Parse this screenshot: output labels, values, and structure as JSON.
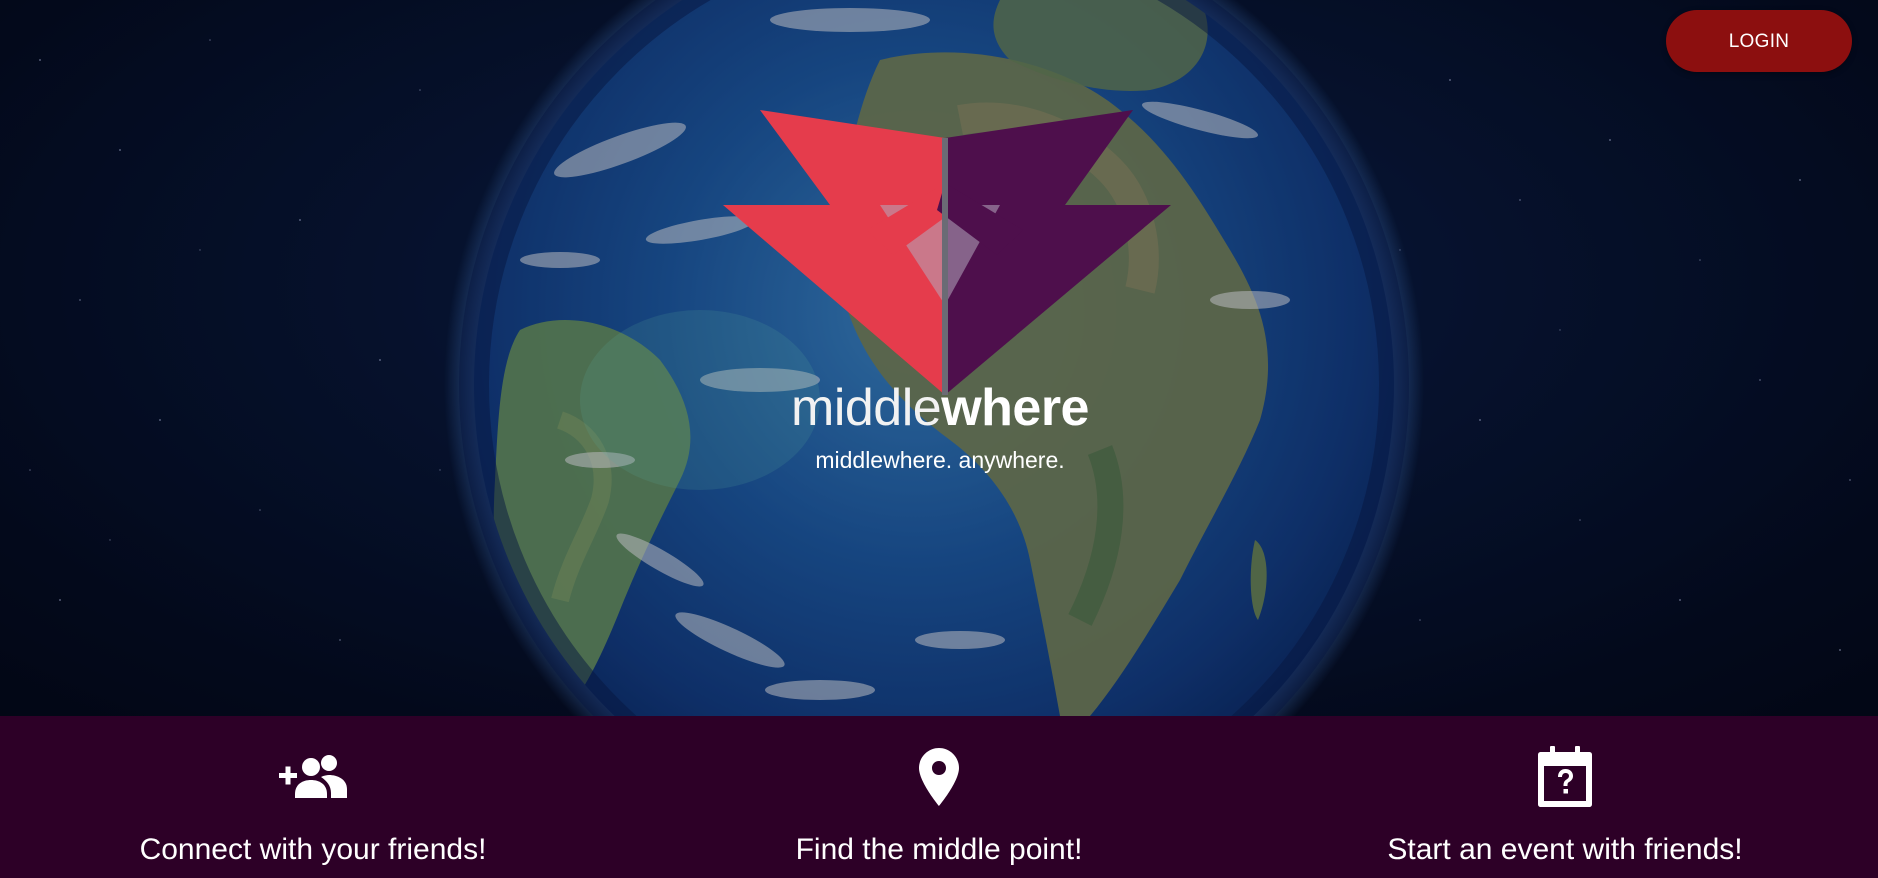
{
  "header": {
    "login_label": "LOGIN"
  },
  "hero": {
    "brand_light": "middle",
    "brand_bold": "where",
    "tagline": "middlewhere. anywhere.",
    "logo_icon": "middlewhere-logo-icon"
  },
  "features": [
    {
      "icon": "add-friends-icon",
      "label": "Connect with your friends!"
    },
    {
      "icon": "location-pin-icon",
      "label": "Find the middle point!"
    },
    {
      "icon": "calendar-question-icon",
      "label": "Start an event with friends!"
    }
  ],
  "colors": {
    "login_button": "#8c0f0f",
    "features_bar": "#2d0027",
    "logo_red": "#e53c4c",
    "logo_purple": "#4e0f4c"
  }
}
